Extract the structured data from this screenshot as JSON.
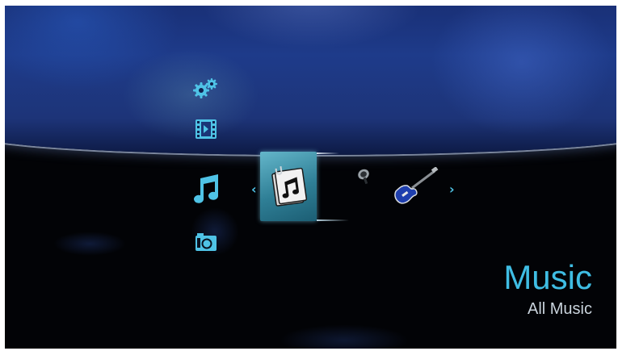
{
  "screen": {
    "title": "Music",
    "subtitle": "All Music"
  },
  "navigation": {
    "prev_arrow": "‹",
    "next_arrow": "›"
  },
  "menu": {
    "vertical_items": [
      {
        "icon": "gear-icon"
      },
      {
        "icon": "film-icon"
      },
      {
        "icon": "music-note-icon"
      },
      {
        "icon": "camera-icon"
      }
    ],
    "horizontal_items": [
      {
        "icon": "music-folder-icon",
        "selected": true
      },
      {
        "icon": "microphone-icon"
      },
      {
        "icon": "guitar-icon"
      }
    ]
  },
  "colors": {
    "accent": "#3fbde3",
    "subtitle": "#c9d3dc",
    "selected_tile": "#2f7f96"
  }
}
